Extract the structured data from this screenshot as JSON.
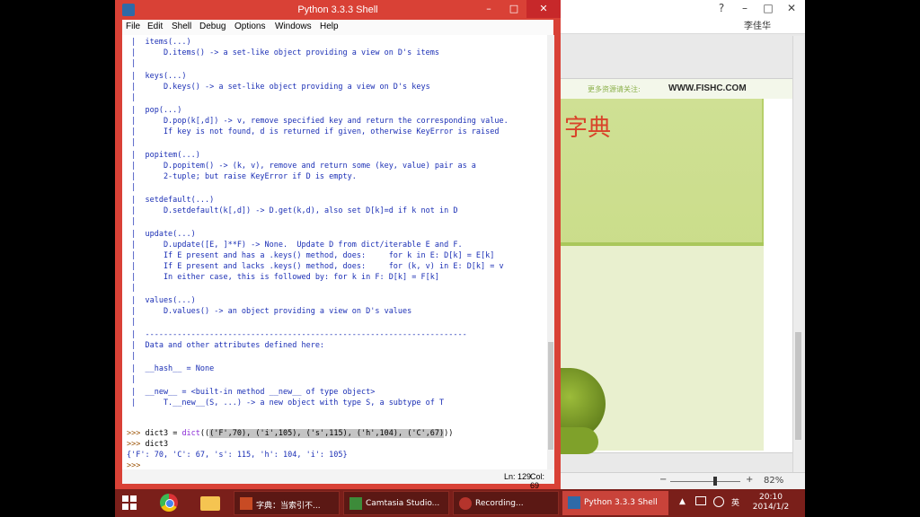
{
  "background_app": {
    "user": "李佳华",
    "slide_ad": "更多资源请关注:",
    "slide_site": "WWW.FISHC.COM",
    "slide_title": "字典",
    "zoom_minus": "−",
    "zoom_plus": "+",
    "zoom_level": "82%",
    "help": "?",
    "minimize": "–",
    "maximize": "□",
    "close": "✕"
  },
  "window": {
    "title": "Python 3.3.3 Shell",
    "minimize": "–",
    "maximize": "□",
    "close": "✕"
  },
  "menu": [
    "File",
    "Edit",
    "Shell",
    "Debug",
    "Options",
    "Windows",
    "Help"
  ],
  "shell_lines": [
    " |  items(...)",
    " |      D.items() -> a set-like object providing a view on D's items",
    " |  ",
    " |  keys(...)",
    " |      D.keys() -> a set-like object providing a view on D's keys",
    " |  ",
    " |  pop(...)",
    " |      D.pop(k[,d]) -> v, remove specified key and return the corresponding value.",
    " |      If key is not found, d is returned if given, otherwise KeyError is raised",
    " |  ",
    " |  popitem(...)",
    " |      D.popitem() -> (k, v), remove and return some (key, value) pair as a",
    " |      2-tuple; but raise KeyError if D is empty.",
    " |  ",
    " |  setdefault(...)",
    " |      D.setdefault(k[,d]) -> D.get(k,d), also set D[k]=d if k not in D",
    " |  ",
    " |  update(...)",
    " |      D.update([E, ]**F) -> None.  Update D from dict/iterable E and F.",
    " |      If E present and has a .keys() method, does:     for k in E: D[k] = E[k]",
    " |      If E present and lacks .keys() method, does:     for (k, v) in E: D[k] = v",
    " |      In either case, this is followed by: for k in F: D[k] = F[k]",
    " |  ",
    " |  values(...)",
    " |      D.values() -> an object providing a view on D's values",
    " |  ",
    " |  ----------------------------------------------------------------------",
    " |  Data and other attributes defined here:",
    " |  ",
    " |  __hash__ = None",
    " |  ",
    " |  __new__ = <built-in method __new__ of type object>",
    " |      T.__new__(S, ...) -> a new object with type S, a subtype of T"
  ],
  "cmd1": {
    "prompt": ">>> ",
    "code_pre": "dict3 = ",
    "builtin": "dict",
    "paren": "((",
    "selected": "('F',70), ('i',105), ('s',115), ('h',104), ('C',67)",
    "close": "))"
  },
  "cmd2": {
    "prompt": ">>> ",
    "code": "dict3"
  },
  "output": "{'F': 70, 'C': 67, 's': 115, 'h': 104, 'i': 105}",
  "cmd3": {
    "prompt": ">>> "
  },
  "status": {
    "line": "Ln: 129",
    "col": "Col: 69"
  },
  "taskbar": {
    "buttons": [
      {
        "label": "字典：当索引不..."
      },
      {
        "label": "Camtasia Studio..."
      },
      {
        "label": "Recording..."
      },
      {
        "label": "Python 3.3.3 Shell"
      }
    ],
    "tray_up": "▲",
    "tray_lang": "英",
    "time": "20:10",
    "date": "2014/1/2"
  },
  "colors": {
    "idle_frame": "#d94136",
    "taskbar": "#7a1f1a",
    "doc_text": "#1b2fb5",
    "prompt": "#9a4f00"
  }
}
